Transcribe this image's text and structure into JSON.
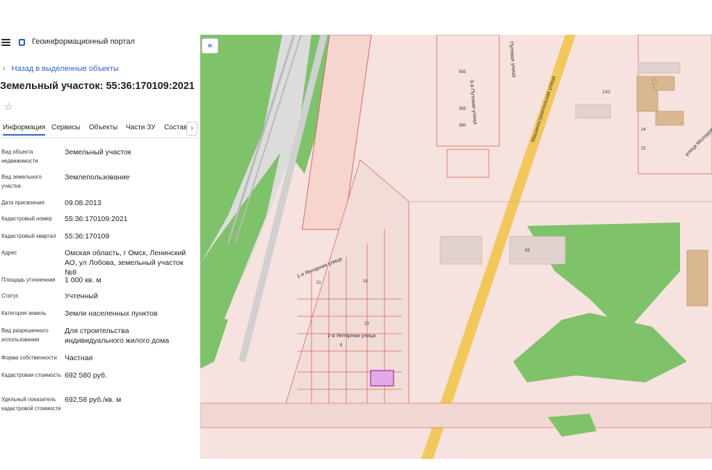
{
  "header": {
    "app_title": "Геоинформационный портал"
  },
  "nav": {
    "back_label": "Назад в выделенные объекты"
  },
  "object": {
    "title": "Земельный участок: 55:36:170109:2021"
  },
  "tabs": [
    "Информация",
    "Сервисы",
    "Объекты",
    "Части ЗУ",
    "Состав"
  ],
  "tabs_more": "›",
  "fields": [
    {
      "label": "Вид объекта недвижимости",
      "value": "Земельный участок"
    },
    {
      "label": "Вид земельного участка",
      "value": "Землепользование"
    },
    {
      "label": "Дата присвоения",
      "value": "09.08.2013"
    },
    {
      "label": "Кадастровый номер",
      "value": "55:36:170109:2021"
    },
    {
      "label": "Кадастровый квартал",
      "value": "55:36:170109"
    },
    {
      "label": "Адрес",
      "value": "Омская область, г Омск, Ленинский АО, ул Лобова, земельный участок №8"
    },
    {
      "label": "Площадь уточненная",
      "value": "1 000 кв. м"
    },
    {
      "label": "Статус",
      "value": "Учтенный"
    },
    {
      "label": "Категория земель",
      "value": "Земли населенных пунктов"
    },
    {
      "label": "Вид разрешенного использования",
      "value": "Для строительства индивидуального жилого дома"
    },
    {
      "label": "Форма собственности",
      "value": "Частная"
    },
    {
      "label": "Кадастровая стоимость",
      "value": "692 580 руб."
    },
    {
      "label": "Удельный показатель кадастровой стоимости",
      "value": "692,58 руб./кв. м"
    }
  ],
  "map": {
    "streets": {
      "yantarnaya1": "1-я Янтарная улица",
      "yantarnaya2": "2-я Янтарная улица",
      "putevaya3": "3-я Путевая улица",
      "putevaya": "Путевая улица",
      "mashinostroitelnaya": "Машиностроительная улица",
      "molodova": "улица Молодова"
    },
    "numbers": [
      "593",
      "385",
      "380",
      "21",
      "18",
      "13",
      "8",
      "93",
      "22",
      "24",
      "13/2"
    ],
    "colors": {
      "green": "#7ec26a",
      "parcel_fill": "#f6e2de",
      "parcel_line": "#d9645d",
      "road": "#f2c85b",
      "selected": "#e6a8e6",
      "rail": "#c8c8c8"
    }
  },
  "collapse_icon": "«"
}
